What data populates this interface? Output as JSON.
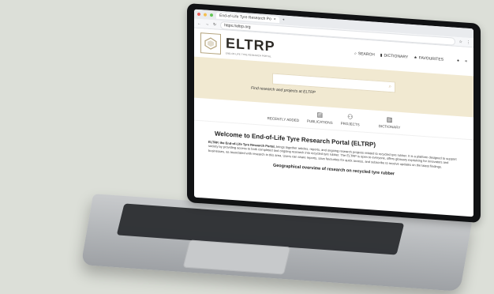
{
  "browser": {
    "tab_title": "End-of-Life Tyre Research Po",
    "tab_close": "×",
    "tab_new": "+",
    "address": "https://eltrp.org"
  },
  "site": {
    "logo": "ELTRP",
    "logo_sub": "END-OF-LIFE TYRE RESEARCH PORTAL",
    "nav": {
      "search": "SEARCH",
      "dictionary": "DICTIONARY",
      "favourites": "FAVOURITES"
    }
  },
  "hero": {
    "search_placeholder": "",
    "caption": "Find research and projects at ELTRP"
  },
  "quick_links": [
    {
      "label": "RECENTLY ADDED"
    },
    {
      "label": "PUBLICATIONS"
    },
    {
      "label": "PROJECTS"
    },
    {
      "label": "DICTIONARY"
    }
  ],
  "content": {
    "welcome_title": "Welcome to End-of-Life Tyre Research Portal (ELTRP)",
    "intro_bold": "ELTRP, the End-of-Life Tyre Research Portal,",
    "intro_text": "brings together articles, reports, and ongoing research projects related to recycled tyre rubber. It is a platform designed to support society by providing access to both completed and ongoing research into recycled tyre rubber. The ELTRP is open to everyone, offers glossary explaining for innovators and businesses, as associated with research in this area. Users can share reports, save favourites for quick access, and subscribe to receive updates on the latest findings.",
    "geo_title": "Geographical overview of research on recycled tyre rubber"
  },
  "colors": {
    "hero_bg": "#f1e9d1",
    "logo_gold": "#b5a57f"
  }
}
